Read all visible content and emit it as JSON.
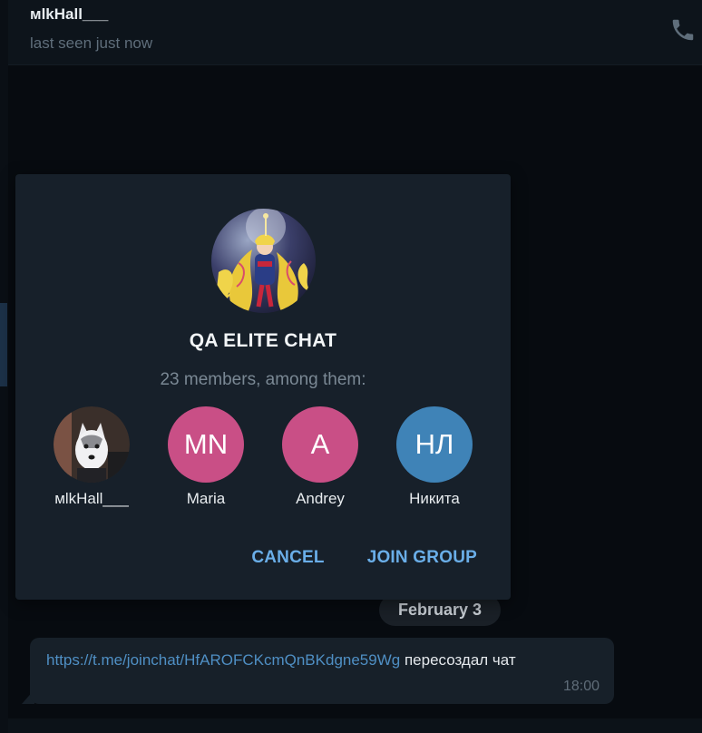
{
  "header": {
    "name": "мlkHall___",
    "status": "last seen just now",
    "call_icon": "phone-icon"
  },
  "modal": {
    "title": "QA ELITE CHAT",
    "subtitle": "23 members, among them:",
    "members": [
      {
        "name": "мlkHall___",
        "initials": "",
        "color": "#4a4a4a",
        "has_photo": true
      },
      {
        "name": "Maria",
        "initials": "MN",
        "color": "#c94f86"
      },
      {
        "name": "Andrey",
        "initials": "A",
        "color": "#c94f86"
      },
      {
        "name": "Никита",
        "initials": "НЛ",
        "color": "#3f83b7"
      }
    ],
    "cancel_label": "CANCEL",
    "join_label": "JOIN GROUP"
  },
  "chat": {
    "date_label": "February 3",
    "message": {
      "link": "https://t.me/joinchat/HfAROFCKcmQnBKdgne59Wg",
      "text": "пересоздал чат",
      "time": "18:00"
    }
  },
  "colors": {
    "accent": "#6aaee8",
    "link": "#4f8fc4",
    "modal_bg": "#17202a",
    "app_bg": "#070b10"
  }
}
